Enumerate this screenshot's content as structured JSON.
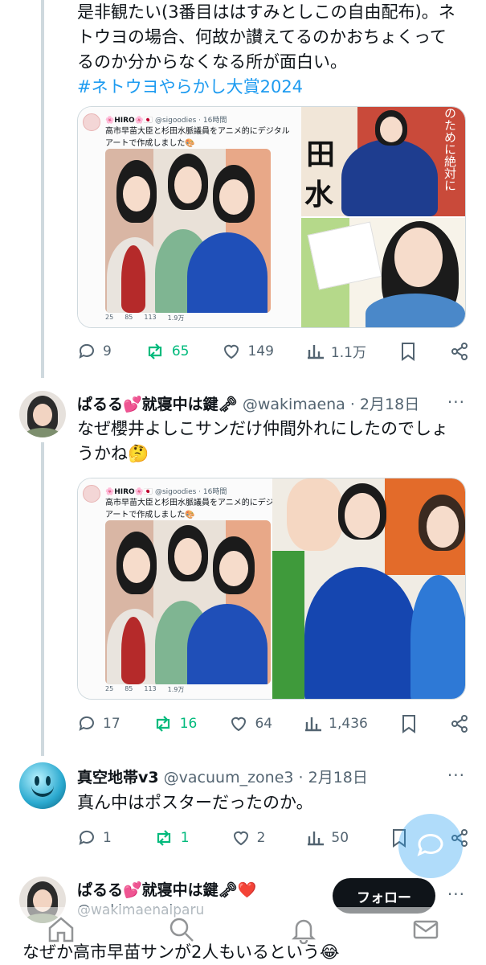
{
  "post1": {
    "text_lines": [
      "是非観たい(3番目ははすみとしこの自由配布)。ネ",
      "トウヨの場合、何故か讃えてるのかおちょくって",
      "るのか分からなくなる所が面白い。"
    ],
    "hashtag": "#ネトウヨやらかし大賞2024",
    "quote": {
      "name": "🌸HIRO🌸🇯🇵",
      "handle": "@sigoodies · 16時間",
      "text": "高市早苗大臣と杉田水脈議員をアニメ的にデジタルアートで作成しました🎨",
      "stats": [
        "25",
        "85",
        "113",
        "1.9万"
      ]
    },
    "right_caption": "のために絶対に",
    "actions": {
      "replies": "9",
      "reposts": "65",
      "likes": "149",
      "views": "1.1万"
    }
  },
  "post2": {
    "name": "ぱるる💕就寝中は鍵🗝",
    "handle": "@wakimaena · 2月18日",
    "text_lines": [
      "なぜ櫻井よしこサンだけ仲間外れにしたのでしょ",
      "うかね🤔"
    ],
    "quote": {
      "name": "🌸HIRO🌸🇯🇵",
      "handle": "@sigoodies · 16時間",
      "text": "高市早苗大臣と杉田水脈議員をアニメ的にデジタルアートで作成しました🎨",
      "stats": [
        "25",
        "85",
        "113",
        "1.9万"
      ]
    },
    "actions": {
      "replies": "17",
      "reposts": "16",
      "likes": "64",
      "views": "1,436"
    }
  },
  "post3": {
    "name": "真空地帯v3",
    "handle": "@vacuum_zone3 · 2月18日",
    "text": "真ん中はポスターだったのか。",
    "actions": {
      "replies": "1",
      "reposts": "1",
      "likes": "2",
      "views": "50"
    }
  },
  "post4": {
    "name": "ぱるる💕就寝中は鍵🗝❤️",
    "handle": "@wakimaenaiparu",
    "follow_label": "フォロー",
    "text": "なぜか高市早苗サンが2人もいるという😂"
  },
  "more_label": "···",
  "colors": {
    "accent": "#1d9bf0",
    "repost": "#00ba7c",
    "muted": "#536471"
  }
}
